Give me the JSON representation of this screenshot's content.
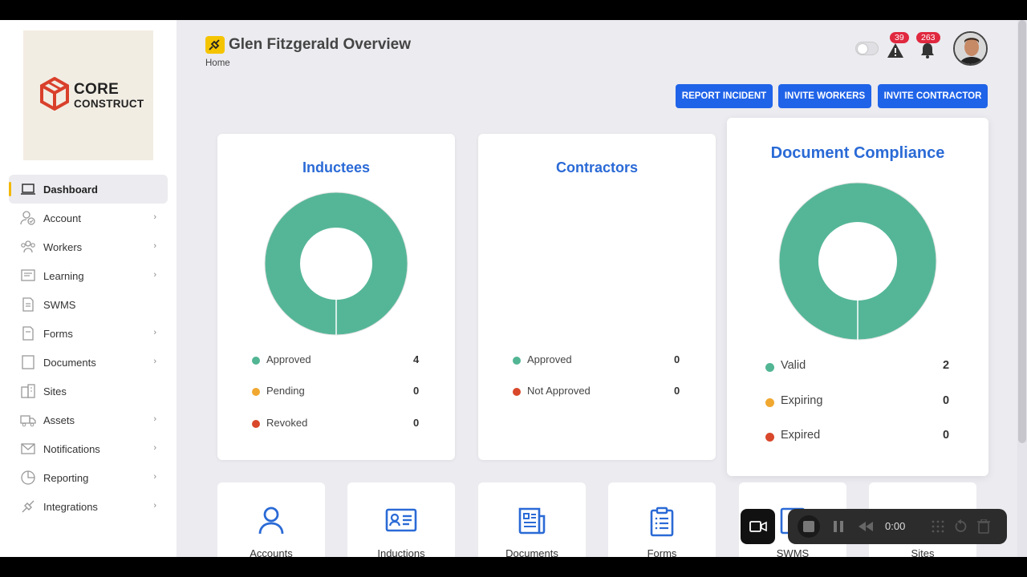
{
  "brand": {
    "line1": "CORE",
    "line2": "CONSTRUCT"
  },
  "header": {
    "title": "Glen Fitzgerald Overview",
    "breadcrumb": "Home",
    "alerts_count": "39",
    "notifications_count": "263"
  },
  "actions": {
    "report_incident": "REPORT INCIDENT",
    "invite_workers": "INVITE WORKERS",
    "invite_contractor": "INVITE CONTRACTOR"
  },
  "sidebar": {
    "items": [
      {
        "label": "Dashboard",
        "icon": "laptop-icon",
        "chevron": false,
        "active": true
      },
      {
        "label": "Account",
        "icon": "user-check-icon",
        "chevron": true
      },
      {
        "label": "Workers",
        "icon": "users-icon",
        "chevron": true
      },
      {
        "label": "Learning",
        "icon": "learning-icon",
        "chevron": true
      },
      {
        "label": "SWMS",
        "icon": "swms-icon",
        "chevron": false
      },
      {
        "label": "Forms",
        "icon": "form-icon",
        "chevron": true
      },
      {
        "label": "Documents",
        "icon": "document-icon",
        "chevron": true
      },
      {
        "label": "Sites",
        "icon": "building-icon",
        "chevron": false
      },
      {
        "label": "Assets",
        "icon": "truck-icon",
        "chevron": true
      },
      {
        "label": "Notifications",
        "icon": "mail-icon",
        "chevron": true
      },
      {
        "label": "Reporting",
        "icon": "pie-chart-icon",
        "chevron": true
      },
      {
        "label": "Integrations",
        "icon": "plug-icon",
        "chevron": true
      }
    ]
  },
  "cards": {
    "inductees": {
      "title": "Inductees",
      "legend": [
        {
          "label": "Approved",
          "value": "4",
          "color": "#52b593"
        },
        {
          "label": "Pending",
          "value": "0",
          "color": "#f0a830"
        },
        {
          "label": "Revoked",
          "value": "0",
          "color": "#d9482b"
        }
      ]
    },
    "contractors": {
      "title": "Contractors",
      "legend": [
        {
          "label": "Approved",
          "value": "0",
          "color": "#52b593"
        },
        {
          "label": "Not Approved",
          "value": "0",
          "color": "#d9482b"
        }
      ]
    },
    "compliance": {
      "title": "Document Compliance",
      "legend": [
        {
          "label": "Valid",
          "value": "2",
          "color": "#52b593"
        },
        {
          "label": "Expiring",
          "value": "0",
          "color": "#f0a830"
        },
        {
          "label": "Expired",
          "value": "0",
          "color": "#d9482b"
        }
      ]
    }
  },
  "tiles": [
    {
      "label": "Accounts",
      "icon": "user-icon"
    },
    {
      "label": "Inductions",
      "icon": "id-card-icon"
    },
    {
      "label": "Documents",
      "icon": "newspaper-icon"
    },
    {
      "label": "Forms",
      "icon": "clipboard-icon"
    },
    {
      "label": "SWMS",
      "icon": "swms-tile-icon"
    },
    {
      "label": "Sites",
      "icon": "sites-tile-icon"
    }
  ],
  "recorder": {
    "time": "0:00"
  },
  "colors": {
    "accent": "#1f63e8",
    "title_blue": "#2a6ad6",
    "donut": "#55b697",
    "badge": "#e0283f"
  }
}
